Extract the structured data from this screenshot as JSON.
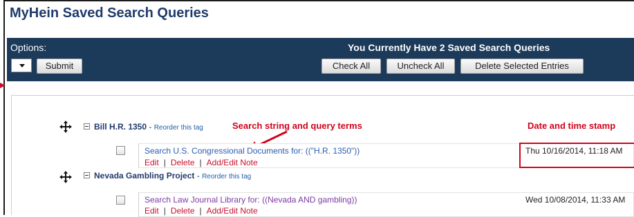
{
  "page": {
    "title": "MyHein Saved Search Queries"
  },
  "toolbar": {
    "options_label": "Options:",
    "select_value": "",
    "submit_label": "Submit",
    "summary_text": "You Currently Have 2 Saved Search Queries",
    "check_all_label": "Check All",
    "uncheck_all_label": "Uncheck All",
    "delete_selected_label": "Delete Selected Entries"
  },
  "annotations": {
    "search_string_label": "Search string and query terms",
    "date_stamp_label": "Date and time stamp",
    "highlight_color": "#d0021b"
  },
  "tags": [
    {
      "name": "Bill H.R. 1350",
      "separator": " - ",
      "reorder_label": "Reorder this tag",
      "entry": {
        "query": "Search U.S. Congressional Documents for: ((\"H.R. 1350\"))",
        "date": "Thu 10/16/2014, 11:18 AM",
        "actions": {
          "edit": "Edit",
          "delete": "Delete",
          "note": "Add/Edit Note",
          "divider": "|"
        }
      }
    },
    {
      "name": "Nevada Gambling Project",
      "separator": " - ",
      "reorder_label": "Reorder this tag",
      "entry": {
        "query": "Search Law Journal Library for: ((Nevada AND gambling))",
        "date": "Wed 10/08/2014, 11:33 AM",
        "actions": {
          "edit": "Edit",
          "delete": "Delete",
          "note": "Add/Edit Note",
          "divider": "|"
        }
      }
    }
  ],
  "colors": {
    "header_bg": "#1c3a5a",
    "title": "#1f3a6b",
    "link_blue": "#2a5db0",
    "link_visited": "#7b3aa4",
    "action_red": "#c8102e"
  }
}
